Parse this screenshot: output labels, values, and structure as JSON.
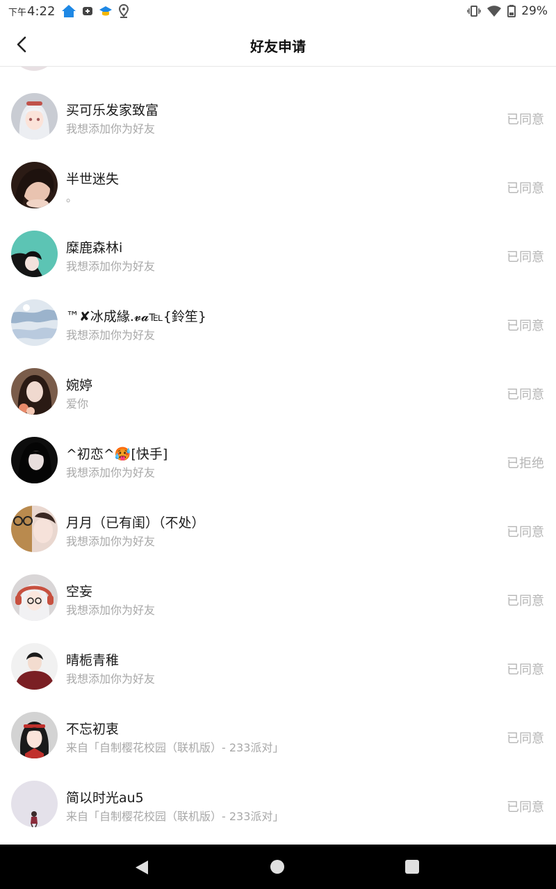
{
  "statusbar": {
    "ampm": "下午",
    "time": "4:22",
    "battery": "29%"
  },
  "header": {
    "title": "好友申请"
  },
  "requests": [
    {
      "name": "买可乐发家致富",
      "message": "我想添加你为好友",
      "status": "已同意"
    },
    {
      "name": "半世迷失",
      "message": "。",
      "status": "已同意"
    },
    {
      "name": "糜鹿森林i",
      "message": "我想添加你为好友",
      "status": "已同意"
    },
    {
      "name": "™✘冰成緣.𝓿𝓪℡{鈴笙}",
      "message": "我想添加你为好友",
      "status": "已同意"
    },
    {
      "name": "婉婷",
      "message": "爱你",
      "status": "已同意"
    },
    {
      "name": "^初恋^🥵[快手]",
      "message": "我想添加你为好友",
      "status": "已拒绝"
    },
    {
      "name": "月月（已有闺）（不处）",
      "message": "我想添加你为好友",
      "status": "已同意"
    },
    {
      "name": "空妄",
      "message": "我想添加你为好友",
      "status": "已同意"
    },
    {
      "name": "晴栀青稚",
      "message": "我想添加你为好友",
      "status": "已同意"
    },
    {
      "name": "不忘初衷",
      "message": "来自「自制樱花校园（联机版）- 233派对」",
      "status": "已同意"
    },
    {
      "name": "简以时光au5",
      "message": "来自「自制樱花校园（联机版）- 233派对」",
      "status": "已同意"
    }
  ],
  "colors": {
    "status_text": "#b5b5b5",
    "secondary_text": "#a8a8a8",
    "accent_blue": "#1e88e5"
  }
}
